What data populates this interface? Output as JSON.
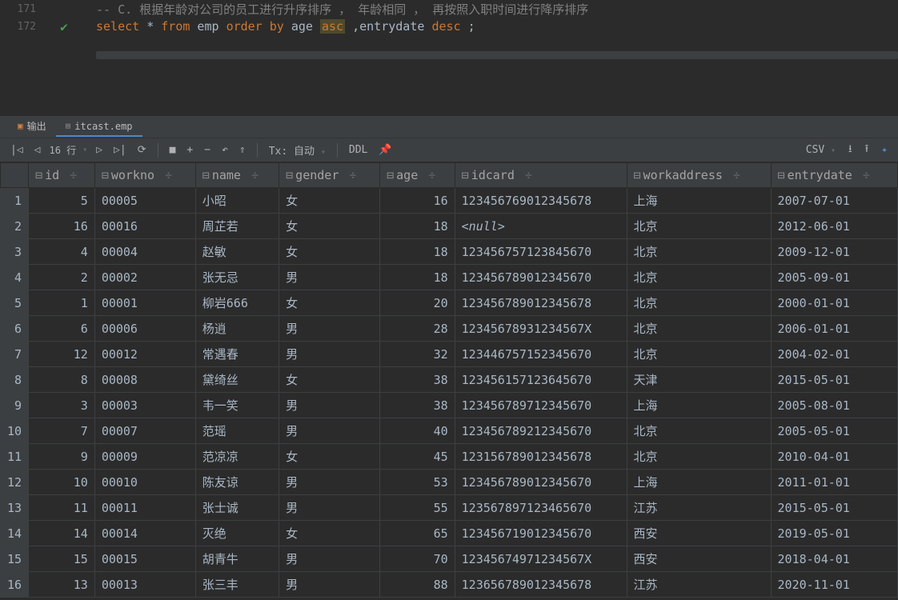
{
  "editor": {
    "lines": [
      {
        "num": "171",
        "check": false,
        "comment": "-- C. 根据年龄对公司的员工进行升序排序 ， 年龄相同 ， 再按照入职时间进行降序排序"
      },
      {
        "num": "172",
        "check": true
      }
    ],
    "sql": {
      "k1": "select",
      "star": " * ",
      "k2": "from",
      "t1": " emp ",
      "k3": "order by",
      "t2": " age ",
      "asc": "asc",
      "t3": " ,entrydate ",
      "k4": "desc",
      "t4": " ;"
    }
  },
  "tabs": {
    "output": "输出",
    "table": "itcast.emp"
  },
  "toolbar": {
    "rows_label": "16 行",
    "tx": "Tx: 自动",
    "ddl": "DDL",
    "csv": "CSV"
  },
  "columns": [
    "id",
    "workno",
    "name",
    "gender",
    "age",
    "idcard",
    "workaddress",
    "entrydate"
  ],
  "rows": [
    {
      "n": "1",
      "id": "5",
      "workno": "00005",
      "name": "小昭",
      "gender": "女",
      "age": "16",
      "idcard": "123456769012345678",
      "workaddress": "上海",
      "entrydate": "2007-07-01"
    },
    {
      "n": "2",
      "id": "16",
      "workno": "00016",
      "name": "周芷若",
      "gender": "女",
      "age": "18",
      "idcard": "<null>",
      "workaddress": "北京",
      "entrydate": "2012-06-01"
    },
    {
      "n": "3",
      "id": "4",
      "workno": "00004",
      "name": "赵敏",
      "gender": "女",
      "age": "18",
      "idcard": "123456757123845670",
      "workaddress": "北京",
      "entrydate": "2009-12-01"
    },
    {
      "n": "4",
      "id": "2",
      "workno": "00002",
      "name": "张无忌",
      "gender": "男",
      "age": "18",
      "idcard": "123456789012345670",
      "workaddress": "北京",
      "entrydate": "2005-09-01"
    },
    {
      "n": "5",
      "id": "1",
      "workno": "00001",
      "name": "柳岩666",
      "gender": "女",
      "age": "20",
      "idcard": "123456789012345678",
      "workaddress": "北京",
      "entrydate": "2000-01-01"
    },
    {
      "n": "6",
      "id": "6",
      "workno": "00006",
      "name": "杨逍",
      "gender": "男",
      "age": "28",
      "idcard": "12345678931234567X",
      "workaddress": "北京",
      "entrydate": "2006-01-01"
    },
    {
      "n": "7",
      "id": "12",
      "workno": "00012",
      "name": "常遇春",
      "gender": "男",
      "age": "32",
      "idcard": "123446757152345670",
      "workaddress": "北京",
      "entrydate": "2004-02-01"
    },
    {
      "n": "8",
      "id": "8",
      "workno": "00008",
      "name": "黛绮丝",
      "gender": "女",
      "age": "38",
      "idcard": "123456157123645670",
      "workaddress": "天津",
      "entrydate": "2015-05-01"
    },
    {
      "n": "9",
      "id": "3",
      "workno": "00003",
      "name": "韦一笑",
      "gender": "男",
      "age": "38",
      "idcard": "123456789712345670",
      "workaddress": "上海",
      "entrydate": "2005-08-01"
    },
    {
      "n": "10",
      "id": "7",
      "workno": "00007",
      "name": "范瑶",
      "gender": "男",
      "age": "40",
      "idcard": "123456789212345670",
      "workaddress": "北京",
      "entrydate": "2005-05-01"
    },
    {
      "n": "11",
      "id": "9",
      "workno": "00009",
      "name": "范凉凉",
      "gender": "女",
      "age": "45",
      "idcard": "123156789012345678",
      "workaddress": "北京",
      "entrydate": "2010-04-01"
    },
    {
      "n": "12",
      "id": "10",
      "workno": "00010",
      "name": "陈友谅",
      "gender": "男",
      "age": "53",
      "idcard": "123456789012345670",
      "workaddress": "上海",
      "entrydate": "2011-01-01"
    },
    {
      "n": "13",
      "id": "11",
      "workno": "00011",
      "name": "张士诚",
      "gender": "男",
      "age": "55",
      "idcard": "123567897123465670",
      "workaddress": "江苏",
      "entrydate": "2015-05-01"
    },
    {
      "n": "14",
      "id": "14",
      "workno": "00014",
      "name": "灭绝",
      "gender": "女",
      "age": "65",
      "idcard": "123456719012345670",
      "workaddress": "西安",
      "entrydate": "2019-05-01"
    },
    {
      "n": "15",
      "id": "15",
      "workno": "00015",
      "name": "胡青牛",
      "gender": "男",
      "age": "70",
      "idcard": "12345674971234567X",
      "workaddress": "西安",
      "entrydate": "2018-04-01"
    },
    {
      "n": "16",
      "id": "13",
      "workno": "00013",
      "name": "张三丰",
      "gender": "男",
      "age": "88",
      "idcard": "123656789012345678",
      "workaddress": "江苏",
      "entrydate": "2020-11-01"
    }
  ]
}
